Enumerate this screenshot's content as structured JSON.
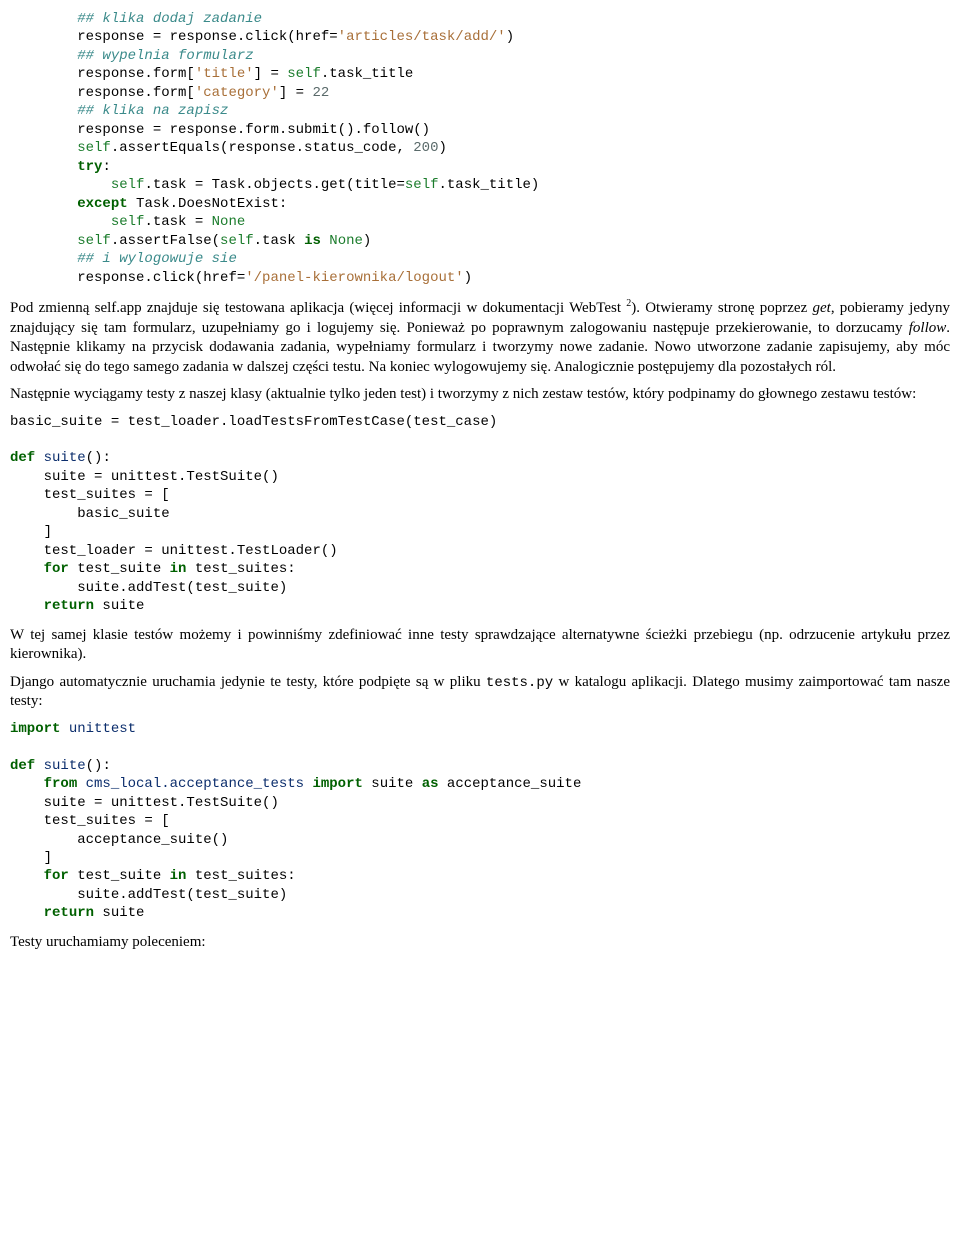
{
  "code1": {
    "l1": {
      "a": "## klika dodaj zadanie"
    },
    "l2": {
      "a": "response = response.click(href=",
      "b": "'articles/task/add/'",
      "c": ")"
    },
    "l3": {
      "a": "## wypelnia formularz"
    },
    "l4": {
      "a": "response.form[",
      "b": "'title'",
      "c": "] = ",
      "d": "self",
      "e": ".task_title"
    },
    "l5": {
      "a": "response.form[",
      "b": "'category'",
      "c": "] = ",
      "d": "22"
    },
    "l6": {
      "a": "## klika na zapisz"
    },
    "l7": {
      "a": "response = response.form.submit().follow()"
    },
    "l8": {
      "a": "self",
      "b": ".assertEquals(response.status_code, ",
      "c": "200",
      "d": ")"
    },
    "l9": {
      "a": "try",
      "b": ":"
    },
    "l10": {
      "a": "    ",
      "b": "self",
      "c": ".task = Task.objects.get(title=",
      "d": "self",
      "e": ".task_title)"
    },
    "l11": {
      "a": "except",
      "b": " Task.DoesNotExist:"
    },
    "l12": {
      "a": "    ",
      "b": "self",
      "c": ".task = ",
      "d": "None"
    },
    "l13": {
      "a": "self",
      "b": ".assertFalse(",
      "c": "self",
      "d": ".task ",
      "e": "is",
      "f": " ",
      "g": "None",
      "h": ")"
    },
    "l14": {
      "a": "## i wylogowuje sie"
    },
    "l15": {
      "a": "response.click(href=",
      "b": "'/panel-kierownika/logout'",
      "c": ")"
    }
  },
  "para1": {
    "a": "Pod zmienną self.app znajduje się testowana aplikacja (więcej informacji w dokumentacji WebTest ",
    "sup": "2",
    "b": "). Otwieramy stronę poprzez ",
    "c": "get",
    "d": ", pobieramy jedyny znajdujący się tam formularz, uzupełniamy go i logujemy się. Ponieważ po poprawnym zalogowaniu następuje przekierowanie, to dorzucamy ",
    "e": "follow",
    "f": ". Następnie klikamy na przycisk dodawania zadania, wypełniamy formularz i tworzymy nowe zadanie. Nowo utworzone zadanie zapisujemy, aby móc odwołać się do tego samego zadania w dalszej części testu. Na koniec wylogowujemy się. Analogicznie postępujemy dla pozostałych ról."
  },
  "para2": "Następnie wyciągamy testy z naszej klasy (aktualnie tylko jeden test) i tworzymy z nich zestaw testów, który podpinamy do głownego zestawu testów:",
  "code2": {
    "l1": {
      "a": "basic_suite = test_loader.loadTestsFromTestCase(test_case)"
    },
    "l2": {
      "a": ""
    },
    "l3": {
      "a": "def",
      "b": " ",
      "c": "suite",
      "d": "():"
    },
    "l4": {
      "a": "    suite = unittest.TestSuite()"
    },
    "l5": {
      "a": "    test_suites = ["
    },
    "l6": {
      "a": "        basic_suite"
    },
    "l7": {
      "a": "    ]"
    },
    "l8": {
      "a": "    test_loader = unittest.TestLoader()"
    },
    "l9": {
      "a": "    ",
      "b": "for",
      "c": " test_suite ",
      "d": "in",
      "e": " test_suites:"
    },
    "l10": {
      "a": "        suite.addTest(test_suite)"
    },
    "l11": {
      "a": "    ",
      "b": "return",
      "c": " suite"
    }
  },
  "para3": "W tej samej klasie testów możemy i powinniśmy zdefiniować inne testy sprawdzające alternatywne ścieżki przebiegu (np. odrzucenie artykułu przez kierownika).",
  "para4": {
    "a": "Django automatycznie uruchamia jedynie te testy, które podpięte są w pliku ",
    "b": "tests.py",
    "c": " w katalogu aplikacji. Dlatego musimy zaimportować tam nasze testy:"
  },
  "code3": {
    "l1": {
      "a": "import",
      "b": " ",
      "c": "unittest"
    },
    "l2": {
      "a": ""
    },
    "l3": {
      "a": "def",
      "b": " ",
      "c": "suite",
      "d": "():"
    },
    "l4": {
      "a": "    ",
      "b": "from",
      "c": " ",
      "d": "cms_local.acceptance_tests",
      "e": " ",
      "f": "import",
      "g": " suite ",
      "h": "as",
      "i": " acceptance_suite"
    },
    "l5": {
      "a": "    suite = unittest.TestSuite()"
    },
    "l6": {
      "a": "    test_suites = ["
    },
    "l7": {
      "a": "        acceptance_suite()"
    },
    "l8": {
      "a": "    ]"
    },
    "l9": {
      "a": "    ",
      "b": "for",
      "c": " test_suite ",
      "d": "in",
      "e": " test_suites:"
    },
    "l10": {
      "a": "        suite.addTest(test_suite)"
    },
    "l11": {
      "a": "    ",
      "b": "return",
      "c": " suite"
    }
  },
  "para5": "Testy uruchamiamy poleceniem:"
}
